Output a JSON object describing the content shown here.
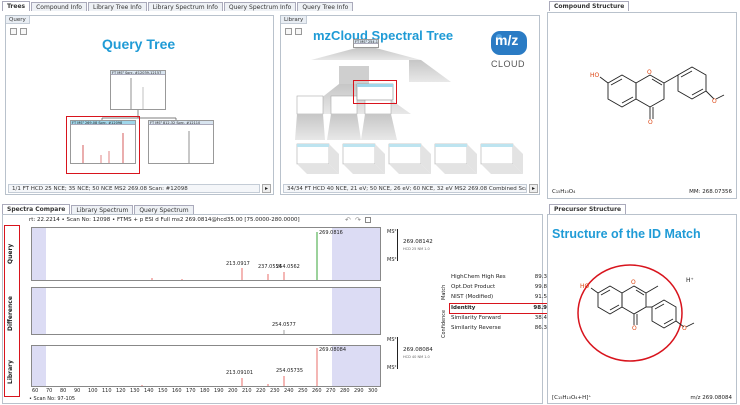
{
  "top_tabs": [
    "Trees",
    "Compound Info",
    "Library Tree Info",
    "Library Spectrum Info",
    "Query Spectrum Info",
    "Query Tree Info"
  ],
  "query_panel": {
    "title": "Query",
    "overlay_label": "Query Tree",
    "root_node": "FT MS² Sorc. #12039-12157",
    "child_node_1": "FT MS² 269.08 Sorc. #12098",
    "child_node_2": "FT MS² 812.32 Sorc. #12110",
    "status": "1/1 FT HCD 25 NCE; 35 NCE; 50 NCE MS2 269.08 Scan: #12098"
  },
  "library_panel": {
    "title": "Library",
    "overlay_label": "mzCloud Spectral Tree",
    "logo_main": "m/z",
    "logo_tm": "TM",
    "logo_sub": "CLOUD",
    "root_node": "FT MS¹ 254.1 3 3",
    "status": "34/34 FT HCD 40 NCE, 21 eV; 50 NCE, 26 eV; 60 NCE, 32 eV MS2 269.08 Combined Scan"
  },
  "compound_structure": {
    "tab": "Compound Structure",
    "formula": "C₁₅H₁₀O₄",
    "mass": "MM: 268.07356",
    "atom_ho": "HO",
    "atom_o_ring": "O",
    "atom_o_keto": "O",
    "atom_o_meth": "O"
  },
  "spectra_tabs": [
    "Spectra Compare",
    "Library Spectrum",
    "Query Spectrum"
  ],
  "spectra": {
    "header": "rt: 22.2214 • Scan No: 12098 • FTMS + p ESI d Full ms2 269.0814@hcd35.00 [75.0000-280.0000]",
    "row_labels": [
      "Query",
      "Difference",
      "Library"
    ],
    "query_peaks": [
      "213.0917",
      "237.0554",
      "254.0562",
      "269.0816"
    ],
    "diff_peak": "254.0577",
    "library_peaks": [
      "213.09101",
      "254.05735",
      "269.08084"
    ],
    "x_ticks": [
      "60",
      "70",
      "80",
      "90",
      "100",
      "110",
      "120",
      "130",
      "140",
      "150",
      "160",
      "170",
      "180",
      "190",
      "200",
      "210",
      "220",
      "230",
      "240",
      "250",
      "260",
      "270",
      "280",
      "290",
      "300"
    ],
    "ms_top": "MS²",
    "ms_bottom": "MS²",
    "ms_lib_top": "MS²",
    "ms_lib_bottom": "MS²",
    "right_val_query": "269.08142",
    "right_sub_query": "HCD 25 NM 1.0",
    "right_val_lib": "269.08084",
    "right_sub_lib": "HCD 40 NM 1.0",
    "scan_no": "• Scan No: 97-105"
  },
  "match": {
    "group1_label": "Match",
    "group2_label": "Confidence",
    "rows": [
      {
        "name": "HighChem High Res",
        "value": "89.3"
      },
      {
        "name": "Opt.Dot Product",
        "value": "99.8"
      },
      {
        "name": "NIST (Modified)",
        "value": "91.5"
      },
      {
        "name": "Identity",
        "value": "98.9"
      },
      {
        "name": "Similarity Forward",
        "value": "38.4"
      },
      {
        "name": "Similarity Reverse",
        "value": "86.3"
      }
    ]
  },
  "precursor_structure": {
    "tab": "Precursor Structure",
    "overlay_label": "Structure of the ID Match",
    "formula": "[C₁₅H₁₀O₄+H]⁺",
    "mass": "m/z 269.08084",
    "h_plus": "H⁺",
    "atom_ho": "HO",
    "atom_o_ring": "O",
    "atom_o_keto": "O",
    "atom_o_meth": "O"
  },
  "colors": {
    "accent_blue": "#1f9bd6",
    "highlight_red": "#d8141d",
    "peak_red": "#e0312b",
    "peak_green": "#3aa63a"
  }
}
